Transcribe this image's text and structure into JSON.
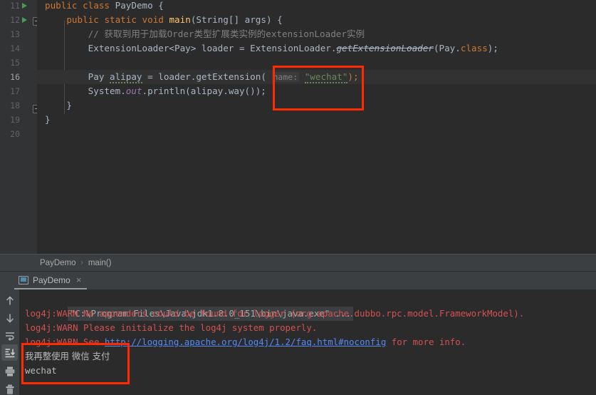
{
  "theme": {
    "editor_bg": "#2b2b2b",
    "gutter_bg": "#313335",
    "panel_bg": "#3c3f41",
    "accent_annotation": "#ff2a00",
    "keyword": "#cc7832",
    "string": "#6a8759",
    "comment": "#808080",
    "method": "#ffc66d",
    "plain": "#a9b7c6",
    "error_text": "#d25252",
    "link": "#548af7",
    "run_marker": "#499c54"
  },
  "editor": {
    "lines": [
      {
        "number": "11",
        "indent": 0,
        "run_marker": true,
        "text": "public class PayDemo {"
      },
      {
        "number": "12",
        "indent": 0,
        "run_marker": true,
        "text": "public static void main(String[] args) {"
      },
      {
        "number": "13",
        "indent": 0,
        "run_marker": false,
        "text": "// 获取到用于加载Order类型扩展类实例的extensionLoader实例"
      },
      {
        "number": "14",
        "indent": 0,
        "run_marker": false,
        "text": "ExtensionLoader<Pay> loader = ExtensionLoader.getExtensionLoader(Pay.class);"
      },
      {
        "number": "15",
        "indent": 0,
        "run_marker": false,
        "text": ""
      },
      {
        "number": "16",
        "indent": 0,
        "run_marker": false,
        "text": "Pay alipay = loader.getExtension( name: \"wechat\");"
      },
      {
        "number": "17",
        "indent": 0,
        "run_marker": false,
        "text": "System.out.println(alipay.way());"
      },
      {
        "number": "18",
        "indent": 0,
        "run_marker": false,
        "text": "}"
      },
      {
        "number": "19",
        "indent": 0,
        "run_marker": false,
        "text": "}"
      },
      {
        "number": "20",
        "indent": 0,
        "run_marker": false,
        "text": ""
      }
    ],
    "current_line": "16",
    "tokens": {
      "l11_kw_public": "public",
      "l11_kw_class": "class",
      "l11_name": "PayDemo",
      "l11_brace": "{",
      "l12_kw_public": "public",
      "l12_kw_static": "static",
      "l12_kw_void": "void",
      "l12_method": "main",
      "l12_params": "(String[] args) {",
      "l13_comment": "// 获取到用于加载Order类型扩展类实例的extensionLoader实例",
      "l14_a": "ExtensionLoader<Pay> loader = ExtensionLoader.",
      "l14_deprecated": "getExtensionLoader",
      "l14_b": "(Pay.",
      "l14_class_kw": "class",
      "l14_c": ");",
      "l16_a": "Pay ",
      "l16_var": "alipay",
      "l16_b": " = loader.getExtension(",
      "l16_inlay": "name:",
      "l16_str": "\"wechat\"",
      "l16_c": ");",
      "l17_a": "System.",
      "l17_field": "out",
      "l17_b": ".println(alipay.way());",
      "l18_brace": "}",
      "l19_brace": "}"
    }
  },
  "breadcrumb": {
    "class": "PayDemo",
    "separator": "›",
    "method": "main()"
  },
  "console": {
    "tab_label": "PayDemo",
    "tab_close": "×",
    "toolbar": [
      {
        "name": "rerun-up-icon",
        "tooltip": "Up the stack trace"
      },
      {
        "name": "rerun-down-icon",
        "tooltip": "Down the stack trace"
      },
      {
        "name": "soft-wrap-icon",
        "tooltip": "Soft-Wrap"
      },
      {
        "name": "scroll-to-end-icon",
        "tooltip": "Scroll to the end",
        "active": true
      },
      {
        "name": "print-icon",
        "tooltip": "Print"
      },
      {
        "name": "clear-all-icon",
        "tooltip": "Clear All"
      }
    ],
    "output": [
      {
        "type": "cmd",
        "text": "\"C:\\Program Files\\Java\\jdk1.8.0_151\\bin\\java.exe\" ..."
      },
      {
        "type": "error",
        "text": "log4j:WARN No appenders could be found for logger (org.apache.dubbo.rpc.model.FrameworkModel)."
      },
      {
        "type": "error",
        "text": "log4j:WARN Please initialize the log4j system properly."
      },
      {
        "type": "error_link",
        "prefix": "log4j:WARN See ",
        "link": "http://logging.apache.org/log4j/1.2/faq.html#noconfig",
        "suffix": " for more info."
      },
      {
        "type": "stdout",
        "text": "我再整使用 微信 支付"
      },
      {
        "type": "stdout",
        "text": "wechat"
      }
    ]
  },
  "annotations": [
    {
      "name": "annotation-box-wechat-argument",
      "target": "line 16 string literal \"wechat\""
    },
    {
      "name": "annotation-box-console-output",
      "target": "console stdout 我再整使用 微信 支付 / wechat"
    }
  ]
}
